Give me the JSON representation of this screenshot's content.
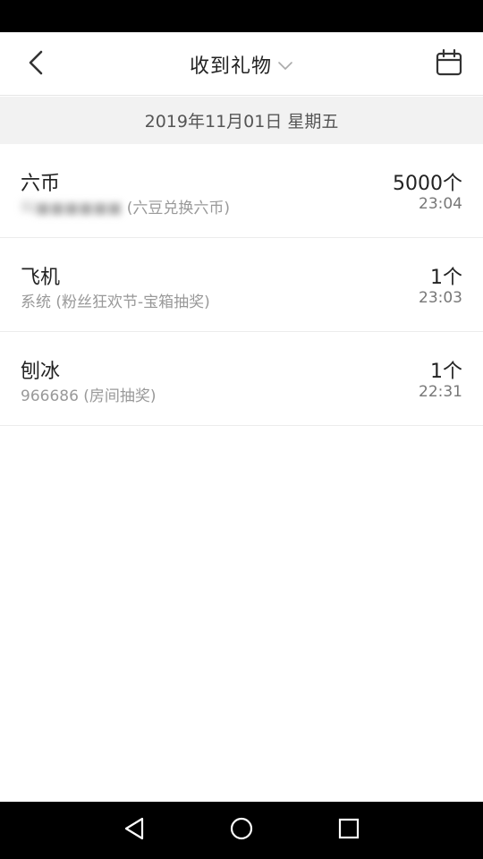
{
  "header": {
    "title": "收到礼物"
  },
  "date_bar": {
    "text": "2019年11月01日 星期五"
  },
  "gifts": [
    {
      "name": "六币",
      "source_blurred": "叫■■■■■■",
      "source": "(六豆兑换六币)",
      "quantity": "5000个",
      "time": "23:04"
    },
    {
      "name": "飞机",
      "source": "系统 (粉丝狂欢节-宝箱抽奖)",
      "quantity": "1个",
      "time": "23:03"
    },
    {
      "name": "刨冰",
      "source": "966686 (房间抽奖)",
      "quantity": "1个",
      "time": "22:31"
    }
  ],
  "icons": {
    "back": "back-arrow-icon",
    "dropdown": "chevron-down-icon",
    "calendar": "calendar-icon",
    "nav_back": "nav-back-icon",
    "nav_home": "nav-home-icon",
    "nav_recents": "nav-recents-icon"
  }
}
